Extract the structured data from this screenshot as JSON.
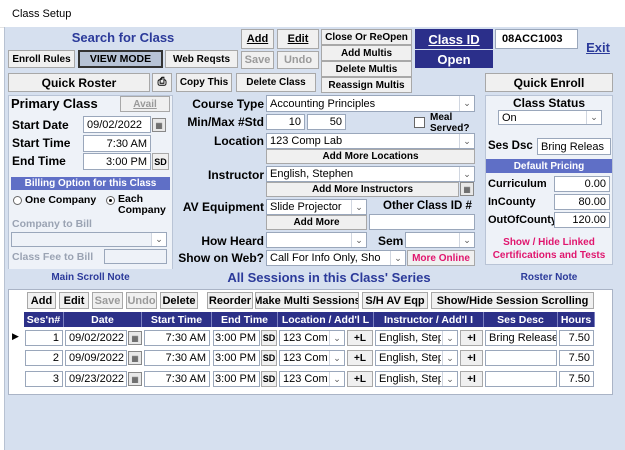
{
  "window": {
    "title": "Class Setup"
  },
  "top": {
    "search_label": "Search for Class",
    "add": "Add",
    "edit": "Edit",
    "save": "Save",
    "undo": "Undo",
    "close_reopen": "Close Or ReOpen",
    "add_multis": "Add Multis",
    "delete_multis": "Delete Multis",
    "reassign_multis": "Reassign Multis",
    "class_id_label": "Class ID",
    "class_id_value": "08ACC1003",
    "status_open": "Open",
    "exit": "Exit",
    "enroll_rules": "Enroll Rules",
    "view_mode": "VIEW MODE",
    "web_reqsts": "Web Reqsts"
  },
  "row2": {
    "quick_roster": "Quick Roster",
    "copy_this": "Copy This",
    "delete_class": "Delete Class",
    "quick_enroll": "Quick Enroll"
  },
  "primary": {
    "title": "Primary Class",
    "avail": "Avail",
    "start_date_label": "Start Date",
    "start_date": "09/02/2022",
    "start_time_label": "Start Time",
    "start_time": "7:30 AM",
    "end_time_label": "End Time",
    "end_time": "3:00 PM",
    "sd": "SD",
    "billing_header": "Billing Option for this Class",
    "one_company": "One Company",
    "each_company": "Each Company",
    "company_to_bill": "Company to Bill",
    "class_fee_to_bill": "Class Fee to Bill",
    "main_scroll_note": "Main Scroll Note"
  },
  "middle": {
    "course_type_label": "Course Type",
    "course_type": "Accounting Principles",
    "minmax_label": "Min/Max #Std",
    "min": "10",
    "max": "50",
    "meal_served": "Meal Served?",
    "location_label": "Location",
    "location": "123 Comp Lab",
    "add_more_locations": "Add More Locations",
    "instructor_label": "Instructor",
    "instructor": "English, Stephen",
    "add_more_instructors": "Add More Instructors",
    "av_label": "AV Equipment",
    "av_value": "Slide Projector",
    "add_more": "Add More",
    "other_class_id": "Other Class ID #",
    "how_heard_label": "How Heard",
    "sem_label": "Sem",
    "show_web_label": "Show on Web?",
    "show_web_value": "Call For Info Only, Sho",
    "more_online": "More Online",
    "series_title": "All Sessions in this Class' Series"
  },
  "right": {
    "class_status_label": "Class Status",
    "class_status": "On",
    "ses_dsc_label": "Ses Dsc",
    "ses_dsc": "Bring Releas",
    "default_pricing": "Default Pricing",
    "curriculum_label": "Curriculum",
    "curriculum": "0.00",
    "incounty_label": "InCounty",
    "incounty": "80.00",
    "outofcounty_label": "OutOfCounty",
    "outofcounty": "120.00",
    "show_hide_linked": "Show / Hide Linked Certifications and Tests",
    "roster_note": "Roster Note"
  },
  "sessions_toolbar": {
    "add": "Add",
    "edit": "Edit",
    "save": "Save",
    "undo": "Undo",
    "delete": "Delete",
    "reorder": "Reorder",
    "make_multi": "Make Multi Sessions",
    "sh_av": "S/H AV Eqp",
    "show_hide_scroll": "Show/Hide Session Scrolling"
  },
  "sessions": {
    "headers": [
      "Ses'n#",
      "Date",
      "Start Time",
      "End Time",
      "Location / Add'l L",
      "Instructor  / Add'l I",
      "Ses Desc",
      "Hours"
    ],
    "rows": [
      {
        "num": "1",
        "date": "09/02/2022",
        "start": "7:30 AM",
        "end": "3:00 PM",
        "sd": "SD",
        "loc": "123 Comp",
        "plus": "+L",
        "inst": "English, Steph",
        "plusi": "+I",
        "desc": "Bring Release",
        "hours": "7.50"
      },
      {
        "num": "2",
        "date": "09/09/2022",
        "start": "7:30 AM",
        "end": "3:00 PM",
        "sd": "SD",
        "loc": "123 Comp",
        "plus": "+L",
        "inst": "English, Steph",
        "plusi": "+I",
        "desc": "",
        "hours": "7.50"
      },
      {
        "num": "3",
        "date": "09/23/2022",
        "start": "7:30 AM",
        "end": "3:00 PM",
        "sd": "SD",
        "loc": "123 Comp",
        "plus": "+L",
        "inst": "English, Steph",
        "plusi": "+I",
        "desc": "",
        "hours": "7.50"
      }
    ]
  },
  "colors": {
    "frame": "#d6e0ef",
    "navy": "#2b2f8a",
    "accent_pink": "#e0166e"
  }
}
